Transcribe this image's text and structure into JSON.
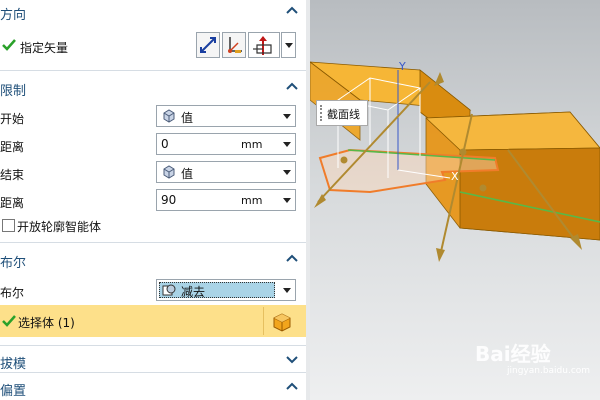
{
  "sections": {
    "direction": {
      "title": "方向",
      "specify_vector_label": "指定矢量"
    },
    "limits": {
      "title": "限制",
      "start_label": "开始",
      "start_value": "值",
      "distance1_label": "距离",
      "distance1_value": "0",
      "distance1_unit": "mm",
      "end_label": "结束",
      "end_value": "值",
      "distance2_label": "距离",
      "distance2_value": "90",
      "distance2_unit": "mm",
      "open_profile_label": "开放轮廓智能体"
    },
    "boolean": {
      "title": "布尔",
      "boolean_label": "布尔",
      "boolean_value": "减去",
      "select_body_label": "选择体 (1)"
    },
    "draft": {
      "title": "拔模"
    },
    "offset": {
      "title": "偏置"
    }
  },
  "viewport": {
    "tooltip": "截面线",
    "axis_y": "Y",
    "axis_x": "X",
    "watermark_brand": "Bai经验",
    "watermark_url": "jingyan.baidu.com"
  },
  "colors": {
    "header_text": "#1f4f79",
    "selected_row": "#fde08a",
    "dropdown_highlight": "#a9d3e6",
    "check_green": "#2aa12a",
    "body_orange": "#f2a51c"
  }
}
